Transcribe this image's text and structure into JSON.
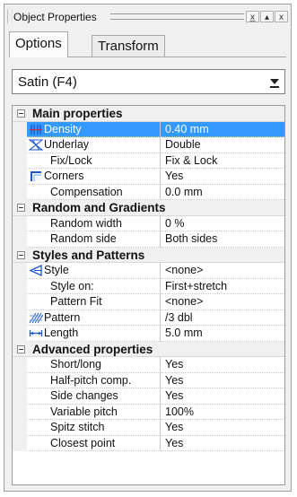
{
  "panel": {
    "title": "Object Properties",
    "buttons": [
      "x̲",
      "▴",
      "x"
    ]
  },
  "tabs": [
    {
      "label": "Options",
      "active": true
    },
    {
      "label": "Transform",
      "active": false
    }
  ],
  "combo": {
    "value": "Satin (F4)"
  },
  "categories": [
    {
      "name": "Main properties",
      "props": [
        {
          "name": "Density",
          "value": "0.40 mm",
          "icon": "density-icon",
          "selected": true
        },
        {
          "name": "Underlay",
          "value": "Double",
          "icon": "underlay-icon"
        },
        {
          "name": "Fix/Lock",
          "value": "Fix & Lock"
        },
        {
          "name": "Corners",
          "value": "Yes",
          "icon": "corners-icon"
        },
        {
          "name": "Compensation",
          "value": "0.0 mm"
        }
      ]
    },
    {
      "name": "Random and Gradients",
      "props": [
        {
          "name": "Random width",
          "value": "0 %"
        },
        {
          "name": "Random side",
          "value": "Both sides"
        }
      ]
    },
    {
      "name": "Styles and Patterns",
      "props": [
        {
          "name": "Style",
          "value": "<none>",
          "icon": "style-icon"
        },
        {
          "name": "Style on:",
          "value": "First+stretch"
        },
        {
          "name": "Pattern Fit",
          "value": "<none>"
        },
        {
          "name": "Pattern",
          "value": "/3 dbl",
          "icon": "pattern-icon"
        },
        {
          "name": "Length",
          "value": "5.0 mm",
          "icon": "length-icon"
        }
      ]
    },
    {
      "name": "Advanced properties",
      "props": [
        {
          "name": "Short/long",
          "value": "Yes"
        },
        {
          "name": "Half-pitch comp.",
          "value": "Yes"
        },
        {
          "name": "Side changes",
          "value": "Yes"
        },
        {
          "name": "Variable pitch",
          "value": "100%"
        },
        {
          "name": "Spitz stitch",
          "value": "Yes"
        },
        {
          "name": "Closest point",
          "value": "Yes"
        }
      ]
    }
  ]
}
